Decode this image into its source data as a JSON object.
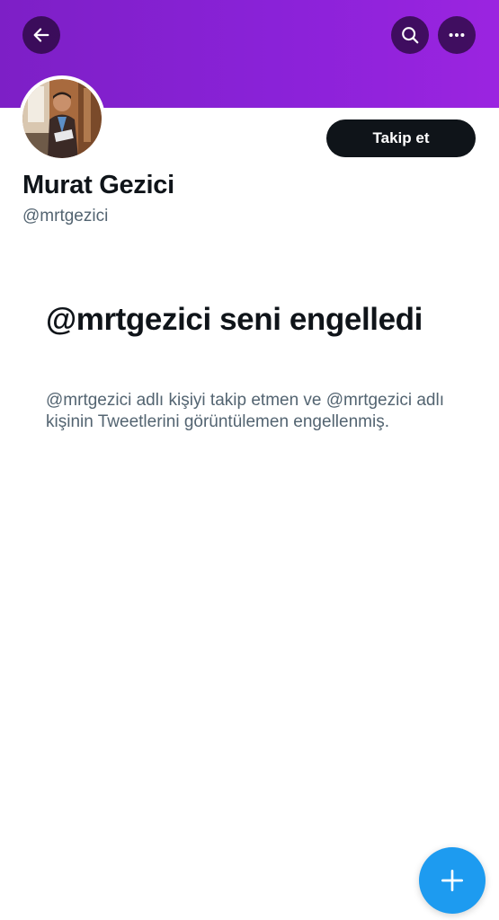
{
  "profile": {
    "display_name": "Murat Gezici",
    "handle": "@mrtgezici",
    "follow_label": "Takip et"
  },
  "blocked": {
    "title": "@mrtgezici seni engelledi",
    "description": "@mrtgezici adlı kişiyi takip etmen ve @mrtgezici adlı kişinin Tweetlerini görüntülemen engellenmiş."
  },
  "icons": {
    "back": "arrow-left-icon",
    "search": "search-icon",
    "more": "more-horizontal-icon",
    "compose": "plus-icon"
  },
  "colors": {
    "banner": "#8a22d8",
    "follow_button": "#0f1419",
    "fab": "#1d9bf0",
    "secondary_text": "#536471"
  }
}
